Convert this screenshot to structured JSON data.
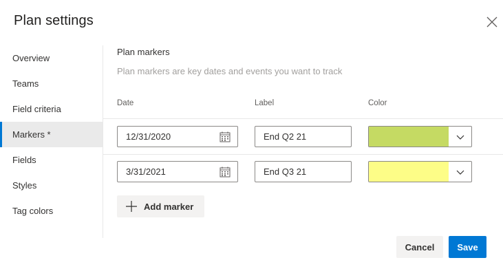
{
  "dialog": {
    "title": "Plan settings"
  },
  "sidebar": {
    "items": [
      {
        "label": "Overview"
      },
      {
        "label": "Teams"
      },
      {
        "label": "Field criteria"
      },
      {
        "label": "Markers *",
        "active": true
      },
      {
        "label": "Fields"
      },
      {
        "label": "Styles"
      },
      {
        "label": "Tag colors"
      }
    ]
  },
  "markers": {
    "title": "Plan markers",
    "description": "Plan markers are key dates and events you want to track",
    "columns": {
      "date": "Date",
      "label": "Label",
      "color": "Color"
    },
    "rows": [
      {
        "date": "12/31/2020",
        "label": "End Q2 21",
        "color": "#c5da63"
      },
      {
        "date": "3/31/2021",
        "label": "End Q3 21",
        "color": "#fdfd87"
      }
    ],
    "add_label": "Add marker"
  },
  "footer": {
    "cancel_label": "Cancel",
    "save_label": "Save"
  },
  "colors": {
    "accent": "#0078d4",
    "nav_active_bg": "#eaeaea",
    "button_bg": "#f3f2f1"
  },
  "icons": {
    "close": "close-icon",
    "calendar": "calendar-icon",
    "chevron": "chevron-down-icon",
    "add": "plus-icon"
  }
}
